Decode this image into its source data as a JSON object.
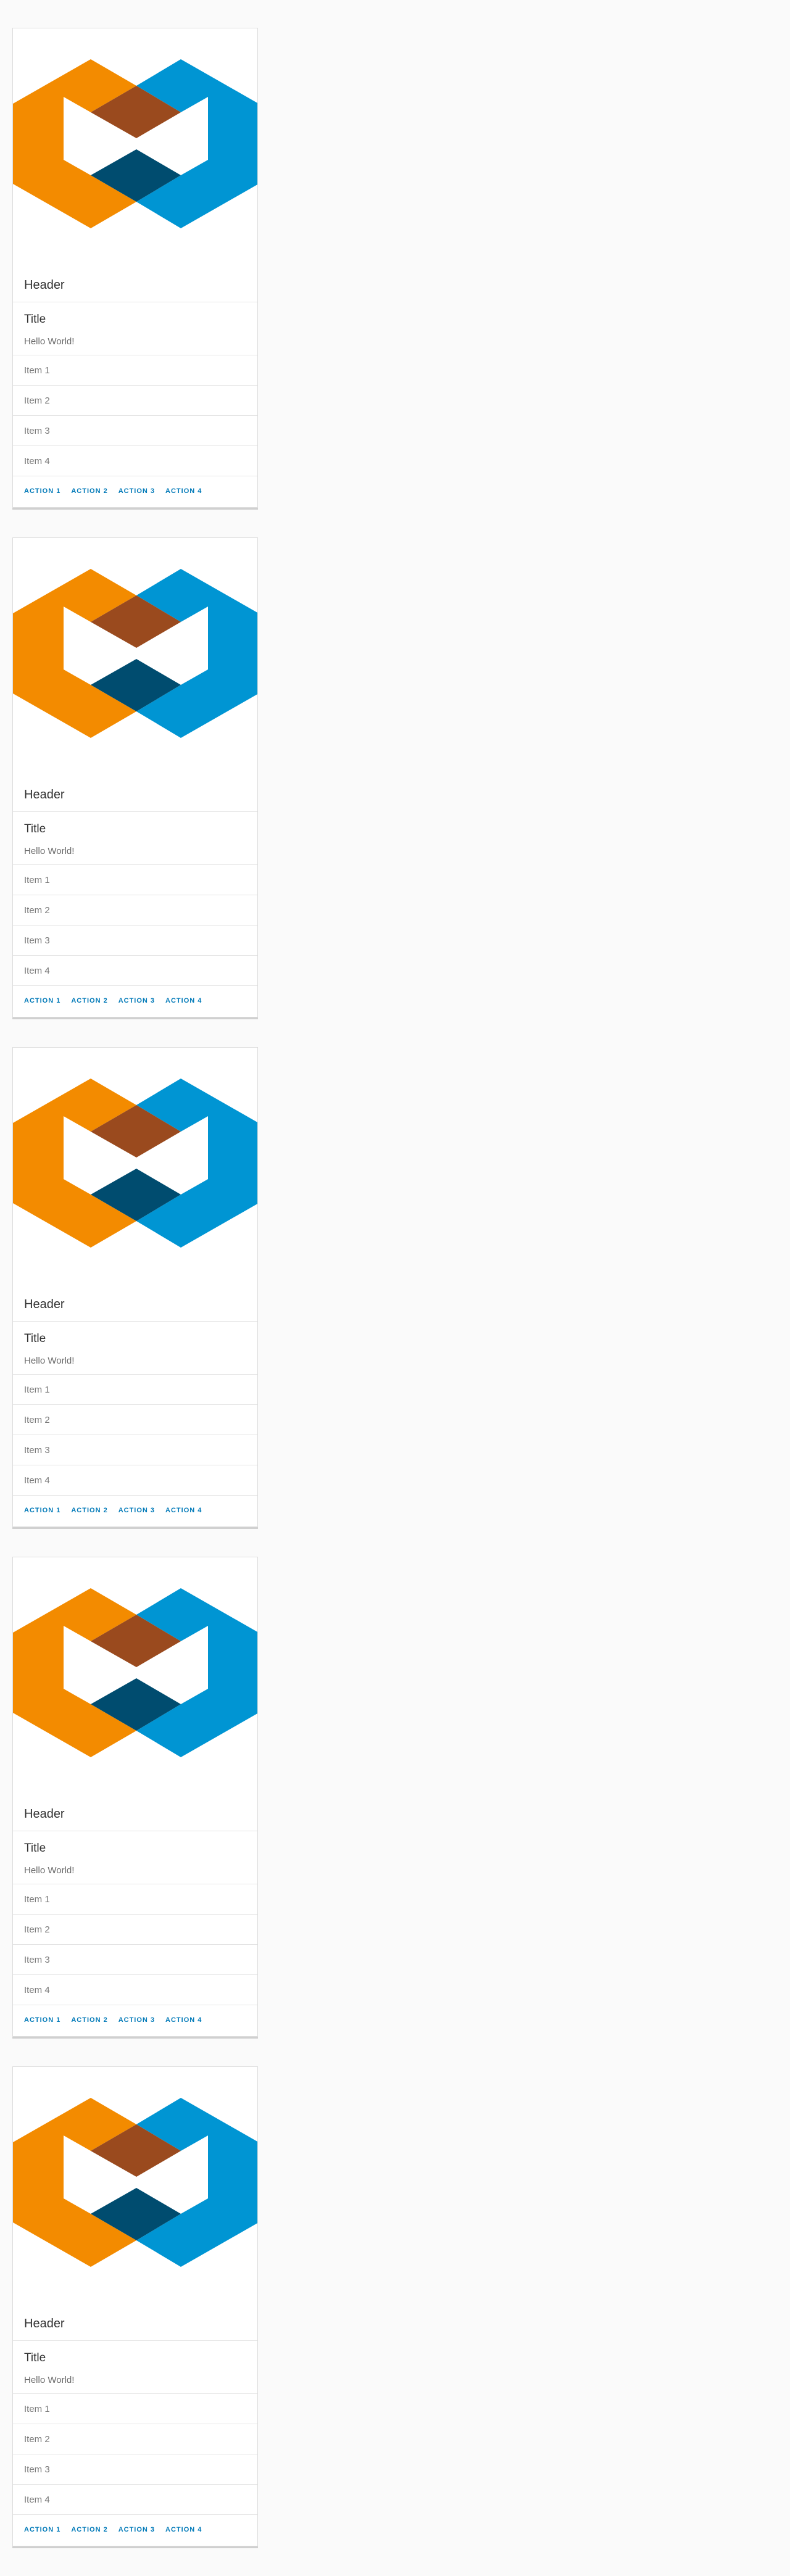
{
  "colors": {
    "orange": "#f38b00",
    "blue": "#0095d3",
    "brown": "#9a4a1e",
    "navy": "#004c6f",
    "action": "#0079b8"
  },
  "cards": [
    {
      "image_icon": "hexagon-logo-icon",
      "header": "Header",
      "title": "Title",
      "text": "Hello World!",
      "items": [
        "Item 1",
        "Item 2",
        "Item 3",
        "Item 4"
      ],
      "actions": [
        "ACTION 1",
        "ACTION 2",
        "ACTION 3",
        "ACTION 4"
      ]
    },
    {
      "image_icon": "hexagon-logo-icon",
      "header": "Header",
      "title": "Title",
      "text": "Hello World!",
      "items": [
        "Item 1",
        "Item 2",
        "Item 3",
        "Item 4"
      ],
      "actions": [
        "ACTION 1",
        "ACTION 2",
        "ACTION 3",
        "ACTION 4"
      ]
    },
    {
      "image_icon": "hexagon-logo-icon",
      "header": "Header",
      "title": "Title",
      "text": "Hello World!",
      "items": [
        "Item 1",
        "Item 2",
        "Item 3",
        "Item 4"
      ],
      "actions": [
        "ACTION 1",
        "ACTION 2",
        "ACTION 3",
        "ACTION 4"
      ]
    },
    {
      "image_icon": "hexagon-logo-icon",
      "header": "Header",
      "title": "Title",
      "text": "Hello World!",
      "items": [
        "Item 1",
        "Item 2",
        "Item 3",
        "Item 4"
      ],
      "actions": [
        "ACTION 1",
        "ACTION 2",
        "ACTION 3",
        "ACTION 4"
      ]
    },
    {
      "image_icon": "hexagon-logo-icon",
      "header": "Header",
      "title": "Title",
      "text": "Hello World!",
      "items": [
        "Item 1",
        "Item 2",
        "Item 3",
        "Item 4"
      ],
      "actions": [
        "ACTION 1",
        "ACTION 2",
        "ACTION 3",
        "ACTION 4"
      ]
    }
  ]
}
